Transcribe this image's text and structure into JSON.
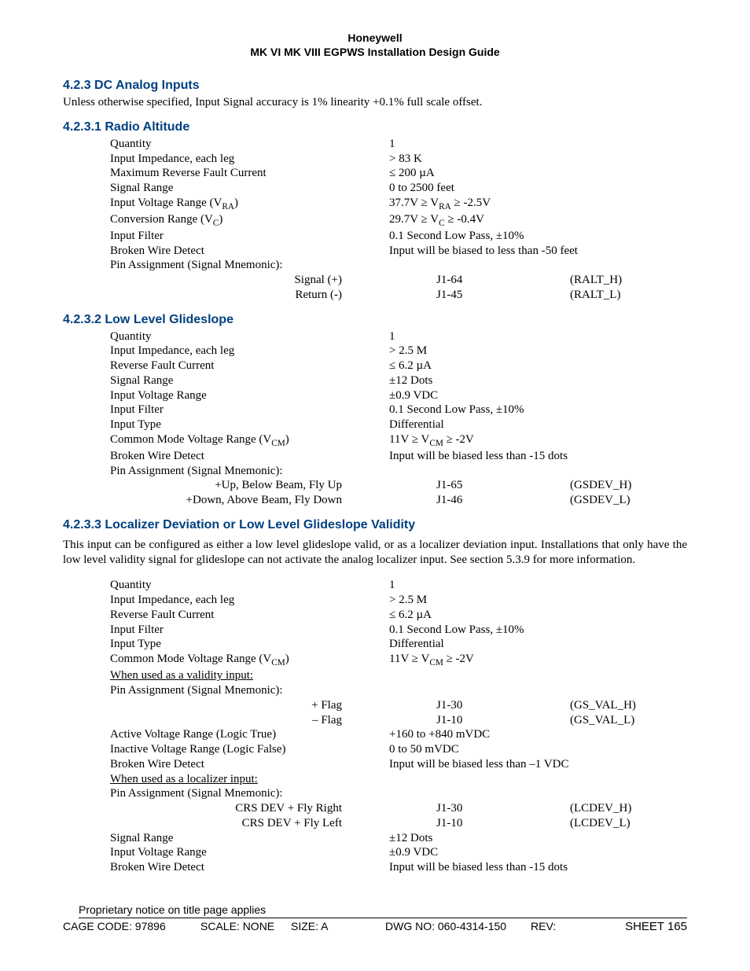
{
  "header": {
    "company": "Honeywell",
    "doc": "MK VI  MK VIII EGPWS Installation Design Guide"
  },
  "s423": {
    "title": "4.2.3  DC Analog Inputs",
    "intro": "Unless otherwise specified, Input Signal accuracy is 1% linearity +0.1% full scale offset."
  },
  "s4231": {
    "title": "4.2.3.1  Radio Altitude",
    "rows": {
      "quantity_l": "Quantity",
      "quantity_v": "1",
      "imp_l": "Input Impedance, each leg",
      "imp_v": "> 83 K",
      "mrfc_l": "Maximum Reverse Fault Current",
      "mrfc_v": "≤ 200 µA",
      "sr_l": "Signal Range",
      "sr_v": "0 to 2500 feet",
      "ivr_l": "Input Voltage Range (V",
      "ivr_sub": "RA",
      "ivr_l2": ")",
      "ivr_v_a": "37.7V ≥ V",
      "ivr_v_sub": "RA",
      "ivr_v_b": " ≥ -2.5V",
      "cr_l": "Conversion Range (V",
      "cr_sub": "C",
      "cr_l2": ")",
      "cr_v_a": "29.7V ≥ V",
      "cr_v_sub": "C",
      "cr_v_b": " ≥ -0.4V",
      "if_l": "Input Filter",
      "if_v": "0.1 Second Low Pass, ±10%",
      "bwd_l": "Broken Wire Detect",
      "bwd_v": "Input will be biased to less than -50 feet",
      "pa_l": "Pin Assignment (Signal Mnemonic):",
      "sig_l": "Signal (+)",
      "sig_v": "J1-64",
      "sig_m": "(RALT_H)",
      "ret_l": "Return (-)",
      "ret_v": "J1-45",
      "ret_m": "(RALT_L)"
    }
  },
  "s4232": {
    "title": "4.2.3.2  Low Level Glideslope",
    "rows": {
      "quantity_l": "Quantity",
      "quantity_v": "1",
      "imp_l": "Input Impedance, each leg",
      "imp_v": "> 2.5 M",
      "rfc_l": "Reverse Fault Current",
      "rfc_v": "≤ 6.2 µA",
      "sr_l": "Signal Range",
      "sr_v": "±12 Dots",
      "ivr_l": "Input Voltage Range",
      "ivr_v": "±0.9 VDC",
      "if_l": "Input Filter",
      "if_v": "0.1 Second Low Pass, ±10%",
      "it_l": "Input Type",
      "it_v": "Differential",
      "cmv_l": "Common Mode Voltage Range (V",
      "cmv_sub": "CM",
      "cmv_l2": ")",
      "cmv_v_a": "11V ≥ V",
      "cmv_v_sub": "CM",
      "cmv_v_b": " ≥ -2V",
      "bwd_l": "Broken Wire Detect",
      "bwd_v": "Input will be biased less than -15 dots",
      "pa_l": "Pin Assignment (Signal Mnemonic):",
      "up_l": "+Up, Below Beam, Fly Up",
      "up_v": "J1-65",
      "up_m": "(GSDEV_H)",
      "dn_l": "+Down, Above Beam, Fly Down",
      "dn_v": "J1-46",
      "dn_m": "(GSDEV_L)"
    }
  },
  "s4233": {
    "title": "4.2.3.3  Localizer Deviation or Low Level Glideslope Validity",
    "para": "This input can be configured as either a low level glideslope valid, or as a localizer deviation input. Installations that only have the low level validity signal for glideslope can not activate the analog localizer input. See section 5.3.9 for more information.",
    "rows": {
      "quantity_l": "Quantity",
      "quantity_v": "1",
      "imp_l": "Input Impedance, each leg",
      "imp_v": "> 2.5 M",
      "rfc_l": "Reverse Fault Current",
      "rfc_v": "≤ 6.2 µA",
      "if_l": "Input Filter",
      "if_v": "0.1 Second Low Pass, ±10%",
      "it_l": "Input Type",
      "it_v": "Differential",
      "cmv_l": "Common Mode Voltage Range (V",
      "cmv_sub": "CM",
      "cmv_l2": ")",
      "cmv_v_a": "11V ≥ V",
      "cmv_v_sub": "CM",
      "cmv_v_b": " ≥ -2V",
      "validity_head": "When used as a validity input:",
      "pa_l": "Pin Assignment (Signal Mnemonic):",
      "flagp_l": "+ Flag",
      "flagp_v": "J1-30",
      "flagp_m": "(GS_VAL_H)",
      "flagm_l": "– Flag",
      "flagm_v": "J1-10",
      "flagm_m": "(GS_VAL_L)",
      "avr_l": "Active Voltage Range (Logic True)",
      "avr_v": "+160 to +840 mVDC",
      "ivr_l": "Inactive Voltage Range (Logic False)",
      "ivr_v": "0 to 50 mVDC",
      "bwd1_l": "Broken Wire Detect",
      "bwd1_v": "Input will be biased less than –1 VDC",
      "localizer_head": "When used as a localizer input:",
      "pa2_l": "Pin Assignment (Signal Mnemonic):",
      "crsr_l": "CRS DEV + Fly Right",
      "crsr_v": "J1-30",
      "crsr_m": "(LCDEV_H)",
      "crsl_l": "CRS DEV + Fly Left",
      "crsl_v": "J1-10",
      "crsl_m": "(LCDEV_L)",
      "sr_l": "Signal Range",
      "sr_v": "±12 Dots",
      "ivr2_l": "Input Voltage Range",
      "ivr2_v": "±0.9 VDC",
      "bwd2_l": "Broken Wire Detect",
      "bwd2_v": "Input will be biased less than -15 dots"
    }
  },
  "footer": {
    "prop": "Proprietary notice on title page applies",
    "cage": "CAGE CODE: 97896",
    "scale": "SCALE: NONE",
    "size": "SIZE: A",
    "dwg": "DWG NO: 060-4314-150",
    "rev": "REV:",
    "sheet": "SHEET 165"
  }
}
